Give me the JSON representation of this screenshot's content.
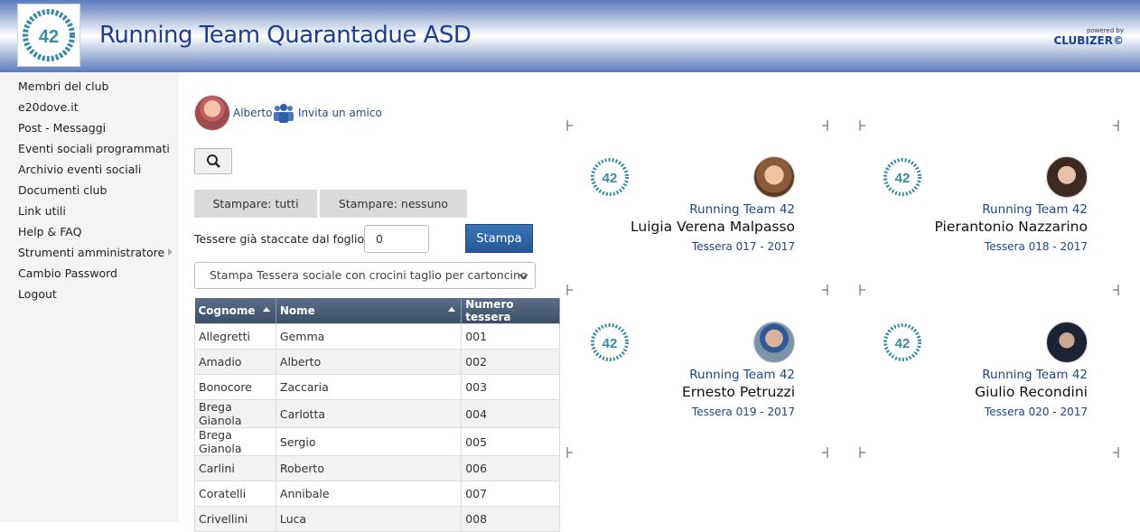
{
  "header": {
    "logo_text": "42",
    "title": "Running Team Quarantadue ASD",
    "powered_small": "powered by",
    "powered_brand": "CLUBIZER©"
  },
  "sidebar": {
    "items": [
      {
        "label": "Membri del club"
      },
      {
        "label": "e20dove.it"
      },
      {
        "label": "Post - Messaggi"
      },
      {
        "label": "Eventi sociali programmati"
      },
      {
        "label": "Archivio eventi sociali"
      },
      {
        "label": "Documenti club"
      },
      {
        "label": "Link utili"
      },
      {
        "label": "Help & FAQ"
      },
      {
        "label": "Strumenti amministratore"
      },
      {
        "label": "Cambio Password"
      },
      {
        "label": "Logout"
      }
    ]
  },
  "user": {
    "name": "Alberto",
    "invite_label": "Invita un amico"
  },
  "toolbar": {
    "print_all": "Stampare: tutti",
    "print_none": "Stampare: nessuno",
    "detached_label": "Tessere già staccate dal foglio :",
    "detached_value": "0",
    "print_button": "Stampa",
    "print_mode": "Stampa Tessera sociale con crocini taglio per cartoncino"
  },
  "table": {
    "headers": [
      "Cognome",
      "Nome",
      "Numero tessera"
    ],
    "rows": [
      [
        "Allegretti",
        "Gemma",
        "001"
      ],
      [
        "Amadio",
        "Alberto",
        "002"
      ],
      [
        "Bonocore",
        "Zaccaria",
        "003"
      ],
      [
        "Brega Gianola",
        "Carlotta",
        "004"
      ],
      [
        "Brega Gianola",
        "Sergio",
        "005"
      ],
      [
        "Carlini",
        "Roberto",
        "006"
      ],
      [
        "Coratelli",
        "Annibale",
        "007"
      ],
      [
        "Crivellini",
        "Luca",
        "008"
      ]
    ]
  },
  "cards": [
    {
      "club": "Running Team 42",
      "person": "Luigia Verena Malpasso",
      "tessera": "Tessera 017 - 2017"
    },
    {
      "club": "Running Team 42",
      "person": "Pierantonio Nazzarino",
      "tessera": "Tessera 018 - 2017"
    },
    {
      "club": "Running Team 42",
      "person": "Ernesto Petruzzi",
      "tessera": "Tessera 019 - 2017"
    },
    {
      "club": "Running Team 42",
      "person": "Giulio Recondini",
      "tessera": "Tessera 020 - 2017"
    }
  ],
  "colors": {
    "brand_blue": "#1d3f93",
    "header_gradient": "#5b7bbb",
    "button_blue": "#2e67a8"
  }
}
